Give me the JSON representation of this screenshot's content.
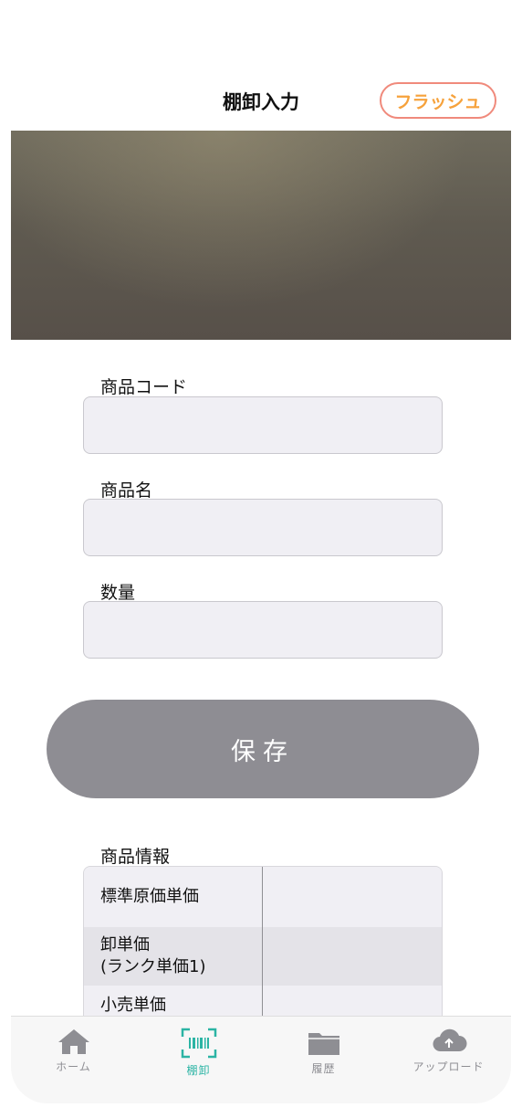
{
  "header": {
    "title": "棚卸入力",
    "flash_label": "フラッシュ"
  },
  "form": {
    "product_code_label": "商品コード",
    "product_code_value": "",
    "product_name_label": "商品名",
    "product_name_value": "",
    "quantity_label": "数量",
    "quantity_value": "",
    "save_label": "保存"
  },
  "product_info": {
    "title": "商品情報",
    "rows": [
      {
        "label": "標準原価単価",
        "value": ""
      },
      {
        "label": "卸単価\n(ランク単価1)",
        "value": ""
      },
      {
        "label": "小売単価",
        "value": ""
      }
    ]
  },
  "tabbar": {
    "items": [
      {
        "label": "ホーム",
        "icon": "home-icon"
      },
      {
        "label": "棚卸",
        "icon": "barcode-scan-icon",
        "active": true
      },
      {
        "label": "履歴",
        "icon": "folder-icon"
      },
      {
        "label": "アップロード",
        "icon": "cloud-upload-icon"
      }
    ],
    "active_color": "#2bb4a4",
    "inactive_color": "#8e8e93"
  },
  "colors": {
    "flash_border": "#f08a7c",
    "flash_text": "#f6a23c",
    "save_bg": "#8e8d93"
  }
}
